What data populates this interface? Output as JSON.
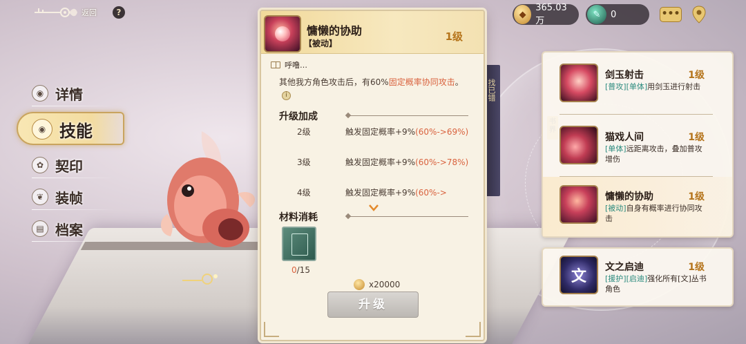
{
  "header": {
    "back_label": "返回",
    "help_label": "?"
  },
  "nav": {
    "items": [
      {
        "label": "详情",
        "icon": "eye-icon",
        "active": false
      },
      {
        "label": "技能",
        "icon": "eye-icon",
        "active": true
      },
      {
        "label": "契印",
        "icon": "seal-icon",
        "active": false
      },
      {
        "label": "装帧",
        "icon": "binding-icon",
        "active": false
      },
      {
        "label": "档案",
        "icon": "archive-icon",
        "active": false
      }
    ]
  },
  "currency": {
    "gold": "365.03万",
    "jade": "0"
  },
  "top_right": {
    "chat_label": "•••"
  },
  "book_side": {
    "spine_text": "找已错"
  },
  "skill_detail": {
    "title": "慵懒的协助",
    "type": "【被动】",
    "level": "1级",
    "quote": "呼噜…",
    "desc_prefix": "其他我方角色攻击后，有60%",
    "desc_highlight": "固定概率协同攻击",
    "desc_suffix": "。",
    "info_icon": "i",
    "upgrade_section": "升级加成",
    "upgrade_rows": [
      {
        "level": "2级",
        "text": "触发固定概率+9%",
        "highlight": "(60%->69%)"
      },
      {
        "level": "3级",
        "text": "触发固定概率+9%",
        "highlight": "(60%->78%)"
      },
      {
        "level": "4级",
        "text": "触发固定概率+9%",
        "highlight": "(60%->"
      }
    ],
    "material_section": "材料消耗",
    "material_have": "0",
    "material_need": "/15",
    "cost": "x20000",
    "upgrade_button": "升级"
  },
  "skills": [
    {
      "name": "剑玉射击",
      "level": "1级",
      "tags": "[普攻][单体]",
      "desc": "用剑玉进行射击",
      "icon": "kendama-icon"
    },
    {
      "name": "猫戏人间",
      "level": "1级",
      "tags": "[单体]",
      "desc": "远距离攻击，叠加普攻增伤",
      "icon": "cat-play-icon"
    },
    {
      "name": "慵懒的协助",
      "level": "1级",
      "tags": "[被动]",
      "desc": "自身有概率进行协同攻击",
      "icon": "lazy-assist-icon"
    },
    {
      "name": "文之启迪",
      "level": "1级",
      "tags": "[援护][启迪]",
      "desc": "强化所有[文]丛书角色",
      "icon": "wen-icon"
    }
  ],
  "book_tag": "书界",
  "wen_glyph": "文"
}
